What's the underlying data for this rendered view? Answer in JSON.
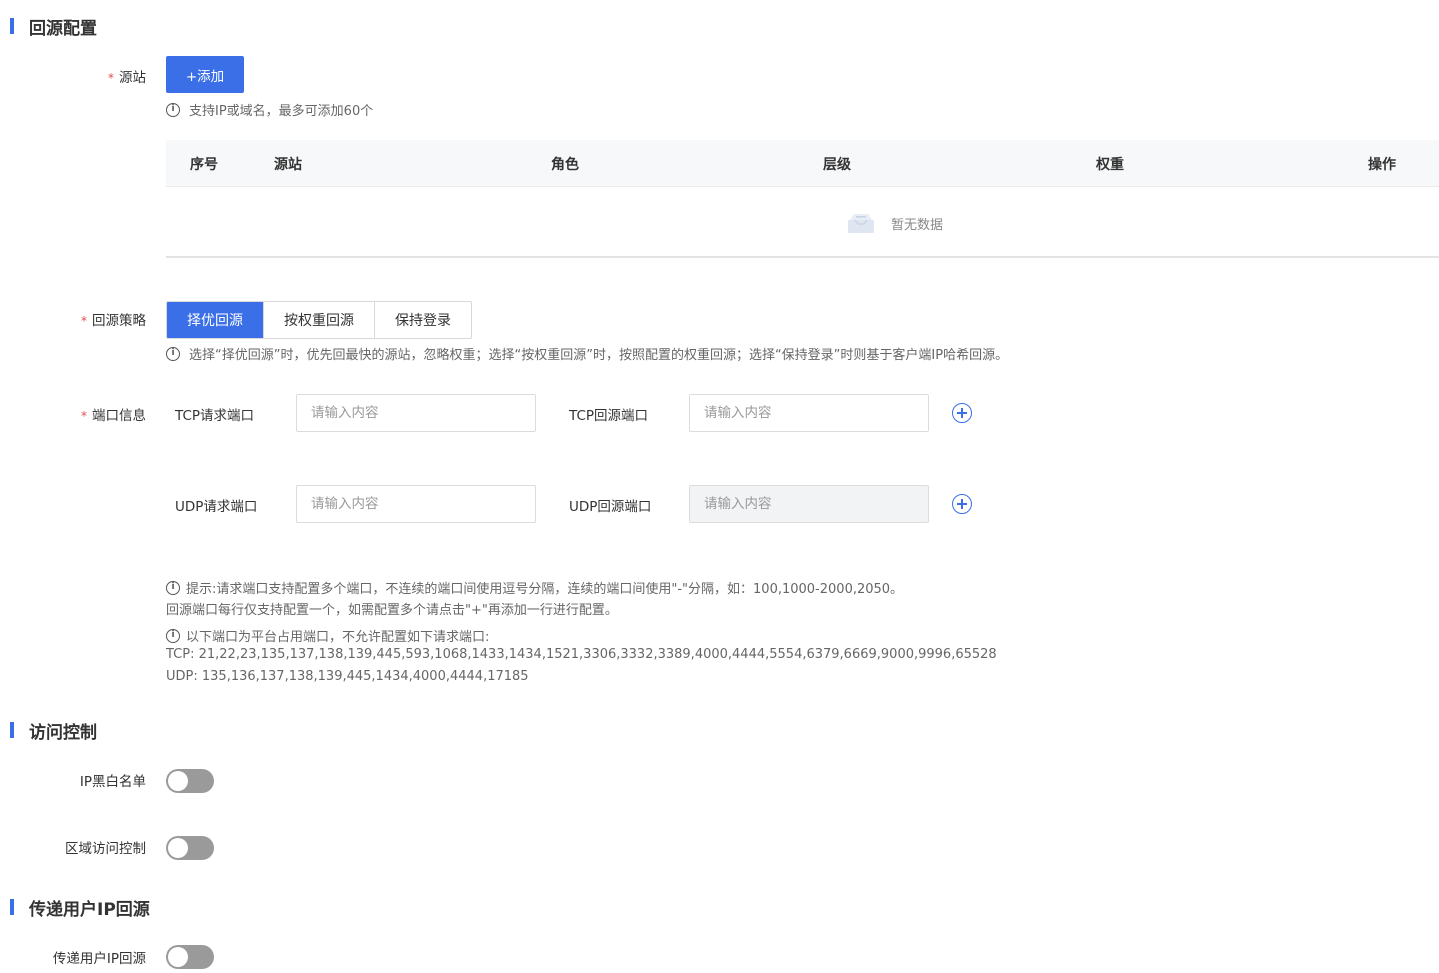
{
  "origin_config": {
    "title": "回源配置",
    "origin_label": "源站",
    "add_button": "+添加",
    "origin_hint": "支持IP或域名，最多可添加60个",
    "table": {
      "columns": [
        "序号",
        "源站",
        "角色",
        "层级",
        "权重",
        "操作"
      ],
      "empty_text": "暂无数据"
    },
    "strategy_label": "回源策略",
    "strategy_options": [
      "择优回源",
      "按权重回源",
      "保持登录"
    ],
    "strategy_selected": "择优回源",
    "strategy_hint": "选择“择优回源”时，优先回最快的源站，忽略权重；选择“按权重回源”时，按照配置的权重回源；选择“保持登录”时则基于客户端IP哈希回源。",
    "port_label": "端口信息",
    "tcp_request_label": "TCP请求端口",
    "tcp_origin_label": "TCP回源端口",
    "udp_request_label": "UDP请求端口",
    "udp_origin_label": "UDP回源端口",
    "input_placeholder": "请输入内容",
    "port_note_1": "提示:请求端口支持配置多个端口，不连续的端口间使用逗号分隔，连续的端口间使用\"-\"分隔，如：100,1000-2000,2050。",
    "port_note_2": "回源端口每行仅支持配置一个，如需配置多个请点击\"+\"再添加一行进行配置。",
    "reserved_note": "以下端口为平台占用端口，不允许配置如下请求端口:",
    "reserved_tcp": "TCP: 21,22,23,135,137,138,139,445,593,1068,1433,1434,1521,3306,3332,3389,4000,4444,5554,6379,6669,9000,9996,65528",
    "reserved_udp": "UDP: 135,136,137,138,139,445,1434,4000,4444,17185"
  },
  "access_control": {
    "title": "访问控制",
    "ip_blacklist_label": "IP黑白名单",
    "ip_blacklist_on": false,
    "region_control_label": "区域访问控制",
    "region_control_on": false
  },
  "client_ip": {
    "title": "传递用户IP回源",
    "toggle_label": "传递用户IP回源",
    "toggle_on": false
  },
  "colors": {
    "primary": "#3a6fe8",
    "required": "#e34d4d",
    "toggle_off": "#9a9a9a"
  }
}
